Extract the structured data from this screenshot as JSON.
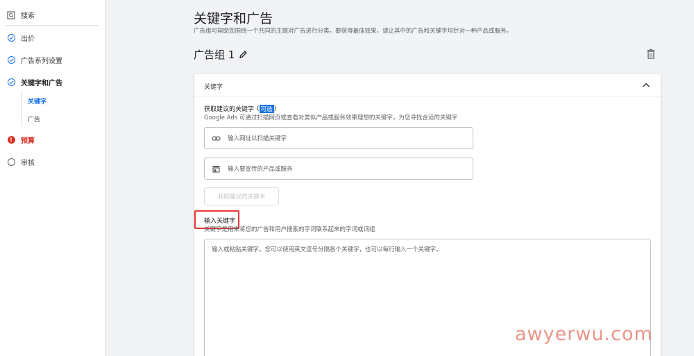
{
  "sidebar": {
    "search": "搜索",
    "items": [
      {
        "label": "出价",
        "status": "done"
      },
      {
        "label": "广告系列设置",
        "status": "done"
      },
      {
        "label": "关键字和广告",
        "status": "done"
      },
      {
        "label": "预算",
        "status": "error"
      },
      {
        "label": "审核",
        "status": "todo"
      }
    ],
    "sub_items": [
      {
        "label": "关键字",
        "active": true
      },
      {
        "label": "广告",
        "active": false
      }
    ]
  },
  "main": {
    "title": "关键字和广告",
    "description": "广告组可帮助您围绕一个共同的主题对广告进行分类。要获得最佳效果，请让其中的广告和关键字均针对一种产品或服务。",
    "group_title": "广告组 1",
    "card": {
      "header": "关键字",
      "suggest_label": "获取建议的关键字",
      "optional": "可选",
      "suggest_desc": "Google Ads 可通过扫描网页或查看对类似产品或服务效果理想的关键字，为您寻找合适的关键字",
      "url_placeholder": "输入网址以扫描关键字",
      "product_placeholder": "输入要宣传的产品或服务",
      "get_button": "获取建议的关键字",
      "keyword_label": "输入关键字",
      "keyword_desc": "关键字是用来将您的广告和用户搜索的字词联系起来的字词或词组",
      "keyword_placeholder": "输入或粘贴关键字。您可以使用英文逗号分隔各个关键字，也可以每行输入一个关键字。"
    }
  },
  "watermark": "awyerwu.com",
  "colors": {
    "accent": "#1a73e8",
    "error": "#d93025",
    "highlight_box": "#e53935"
  }
}
